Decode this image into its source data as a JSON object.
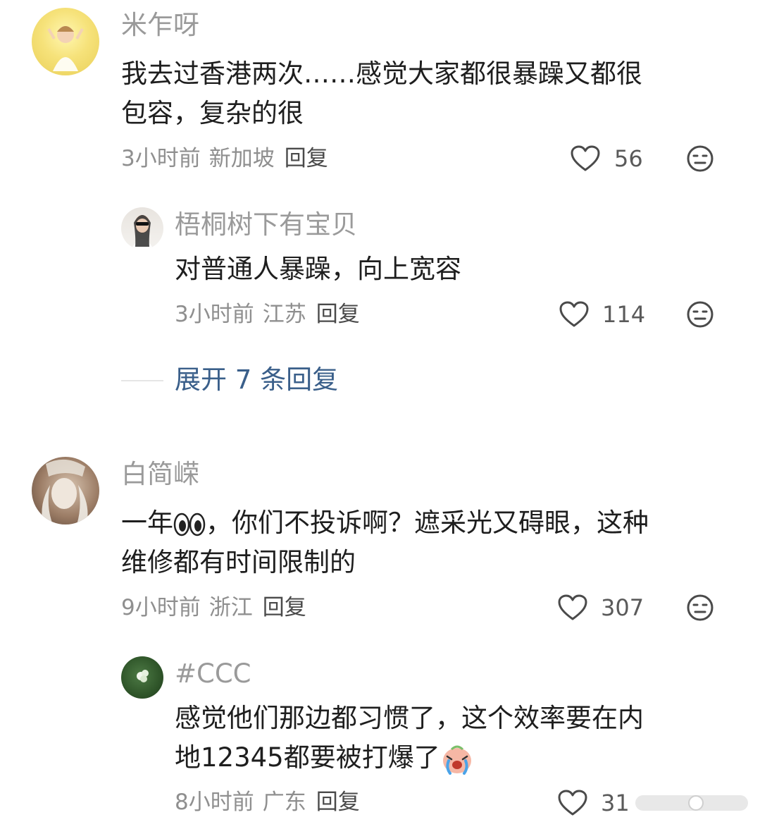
{
  "comments": [
    {
      "user": "米乍呀",
      "lines": [
        "我去过香港两次……感觉大家都很暴躁又都很",
        "包容，复杂的很"
      ],
      "time": "3小时前",
      "location": "新加坡",
      "reply_label": "回复",
      "likes": "56",
      "replies": [
        {
          "user": "梧桐树下有宝贝",
          "lines": [
            "对普通人暴躁，向上宽容"
          ],
          "time": "3小时前",
          "location": "江苏",
          "reply_label": "回复",
          "likes": "114"
        }
      ],
      "expand_label": "展开 7 条回复"
    },
    {
      "user": "白简嵘",
      "line1_before": "一年",
      "line1_after": "，你们不投诉啊？遮采光又碍眼，这种",
      "line2": "维修都有时间限制的",
      "time": "9小时前",
      "location": "浙江",
      "reply_label": "回复",
      "likes": "307",
      "replies": [
        {
          "user": "#CCC",
          "lines": [
            "感觉他们那边都习惯了，这个效率要在内",
            "地12345都要被打爆了"
          ],
          "time": "8小时前",
          "location": "广东",
          "reply_label": "回复",
          "likes": "31"
        }
      ]
    }
  ],
  "icons": {
    "like": "heart-outline-icon",
    "more": "neutral-face-icon",
    "eyes": "eyes-emoji",
    "crying": "crying-emoji"
  },
  "colors": {
    "name": "#9a9a9a",
    "text": "#1e1e1e",
    "meta": "#8f8f8f",
    "expand": "#3a5f8a"
  }
}
